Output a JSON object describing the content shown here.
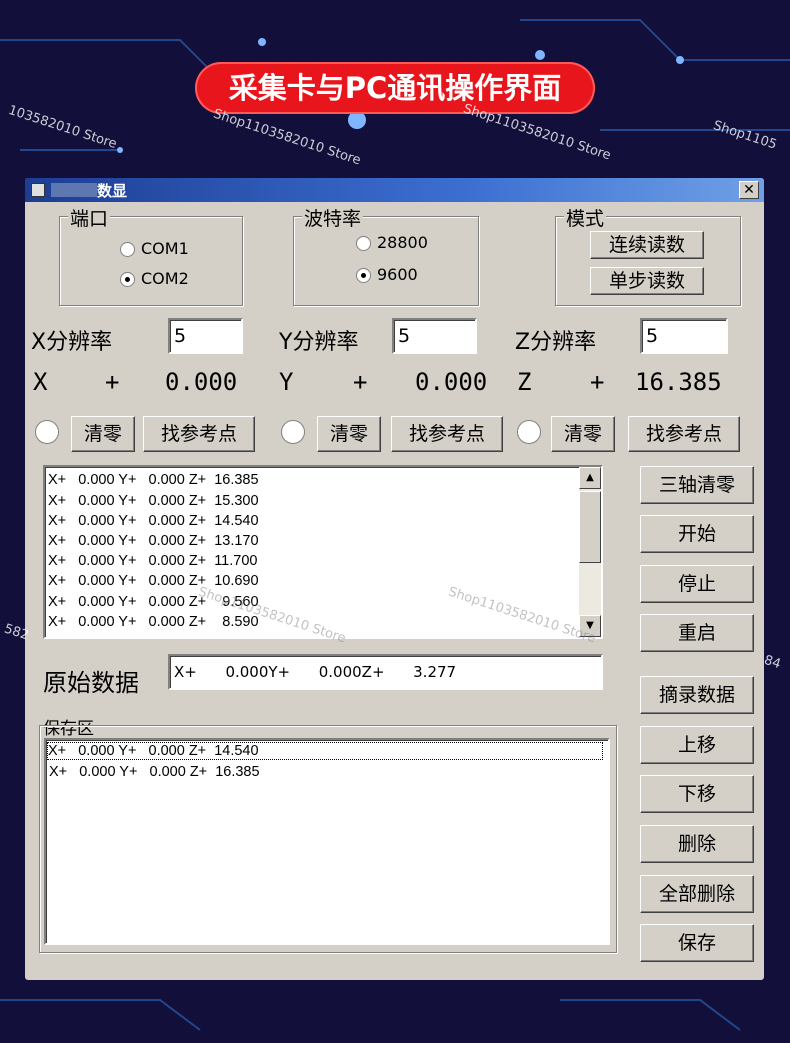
{
  "banner": {
    "title": "采集卡与PC通讯操作界面"
  },
  "watermarks": [
    "103582010 Store",
    "Shop1103582010 Store",
    "Shop1103582010 Store",
    "Shop1105",
    "Shop1103582010 Store",
    "582",
    "Shop1103582010 Store",
    "84"
  ],
  "window": {
    "title": "数显",
    "close": "✕"
  },
  "port": {
    "label": "端口",
    "options": [
      {
        "label": "COM1",
        "selected": false
      },
      {
        "label": "COM2",
        "selected": true
      }
    ]
  },
  "baud": {
    "label": "波特率",
    "options": [
      {
        "label": "28800",
        "selected": false
      },
      {
        "label": "9600",
        "selected": true
      }
    ]
  },
  "mode": {
    "label": "模式",
    "continuous": "连续读数",
    "single": "单步读数"
  },
  "resolution": {
    "x_label": "X分辨率",
    "x_value": "5",
    "y_label": "Y分辨率",
    "y_value": "5",
    "z_label": "Z分辨率",
    "z_value": "5"
  },
  "readout": {
    "x_axis": "X",
    "x_sign": "+",
    "x_value": "0.000",
    "y_axis": "Y",
    "y_sign": "+",
    "y_value": "0.000",
    "z_axis": "Z",
    "z_sign": "+",
    "z_value": "16.385"
  },
  "axis_buttons": {
    "clear": "清零",
    "find_ref": "找参考点"
  },
  "data_list": [
    "X+   0.000 Y+   0.000 Z+  16.385",
    "X+   0.000 Y+   0.000 Z+  15.300",
    "X+   0.000 Y+   0.000 Z+  14.540",
    "X+   0.000 Y+   0.000 Z+  13.170",
    "X+   0.000 Y+   0.000 Z+  11.700",
    "X+   0.000 Y+   0.000 Z+  10.690",
    "X+   0.000 Y+   0.000 Z+    9.560",
    "X+   0.000 Y+   0.000 Z+    8.590"
  ],
  "raw": {
    "label": "原始数据",
    "value": "X+      0.000Y+      0.000Z+      3.277"
  },
  "save_area": {
    "label": "保存区",
    "items": [
      "X+   0.000 Y+   0.000 Z+  14.540",
      "X+   0.000 Y+   0.000 Z+  16.385"
    ]
  },
  "side_buttons": {
    "zero_all": "三轴清零",
    "start": "开始",
    "stop": "停止",
    "restart": "重启",
    "capture": "摘录数据",
    "move_up": "上移",
    "move_down": "下移",
    "delete": "删除",
    "delete_all": "全部删除",
    "save": "保存"
  }
}
